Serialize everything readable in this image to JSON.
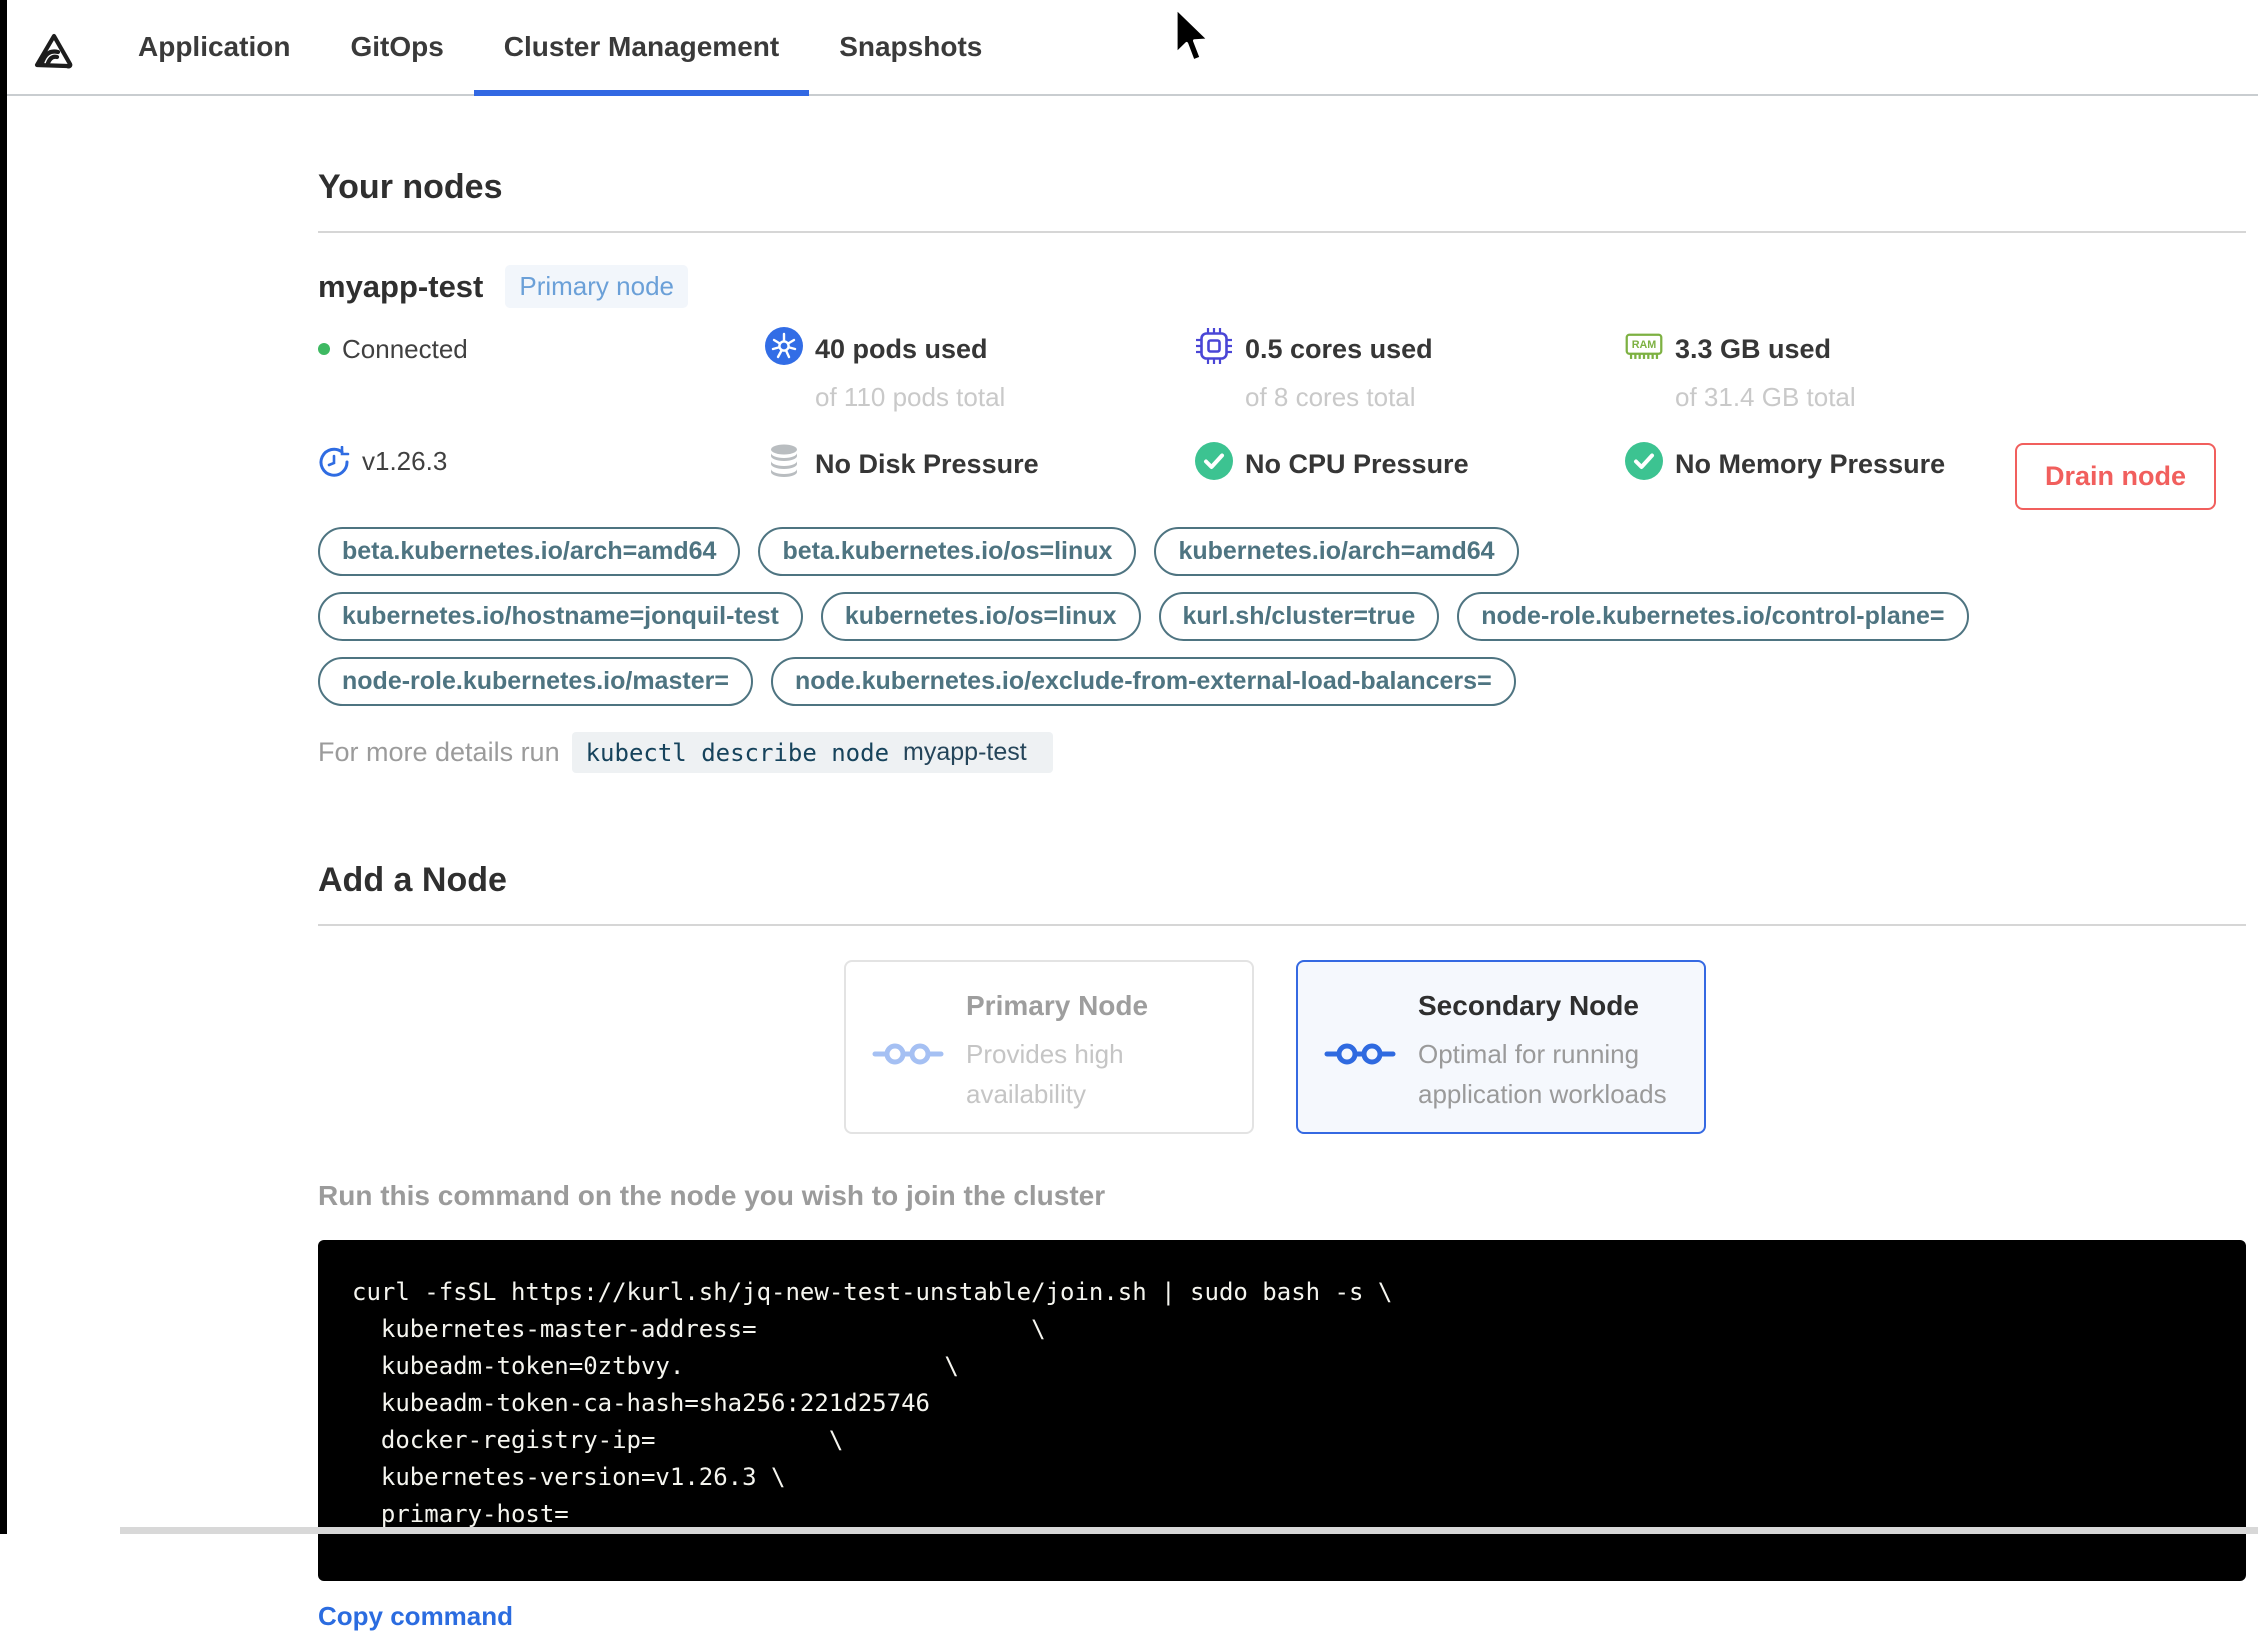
{
  "nav": {
    "tabs": [
      {
        "label": "Application"
      },
      {
        "label": "GitOps"
      },
      {
        "label": "Cluster Management"
      },
      {
        "label": "Snapshots"
      }
    ],
    "active_tab": "Cluster Management"
  },
  "your_nodes": {
    "title": "Your nodes",
    "node": {
      "name": "myapp-test",
      "badge": "Primary node",
      "status": "Connected",
      "version": "v1.26.3",
      "stats": [
        {
          "icon": "kubernetes-pods-icon",
          "label": "40 pods used",
          "sub": "of 110 pods total"
        },
        {
          "icon": "cpu-icon",
          "label": "0.5 cores used",
          "sub": "of 8 cores total"
        },
        {
          "icon": "ram-icon",
          "label": "3.3 GB used",
          "sub": "of 31.4 GB total"
        }
      ],
      "conditions": [
        {
          "icon": "disk-icon",
          "label": "No Disk Pressure"
        },
        {
          "icon": "check-circle-icon",
          "label": "No CPU Pressure"
        },
        {
          "icon": "check-circle-icon",
          "label": "No Memory Pressure"
        }
      ],
      "labels": [
        "beta.kubernetes.io/arch=amd64",
        "beta.kubernetes.io/os=linux",
        "kubernetes.io/arch=amd64",
        "kubernetes.io/hostname=jonquil-test",
        "kubernetes.io/os=linux",
        "kurl.sh/cluster=true",
        "node-role.kubernetes.io/control-plane=",
        "node-role.kubernetes.io/master=",
        "node.kubernetes.io/exclude-from-external-load-balancers="
      ],
      "details_prefix": "For more details run",
      "details_command": "kubectl describe node",
      "details_node": "myapp-test",
      "drain_button": "Drain node"
    }
  },
  "add_node": {
    "title": "Add a Node",
    "options": [
      {
        "title": "Primary Node",
        "description": "Provides high availability",
        "selected": false
      },
      {
        "title": "Secondary Node",
        "description": "Optimal for running application workloads",
        "selected": true
      }
    ],
    "instruction": "Run this command on the node you wish to join the cluster",
    "command_lines": [
      "curl -fsSL https://kurl.sh/jq-new-test-unstable/join.sh | sudo bash -s \\",
      "  kubernetes-master-address=                   \\",
      "  kubeadm-token=0ztbvy.                  \\",
      "  kubeadm-token-ca-hash=sha256:221d25746",
      "  docker-registry-ip=            \\",
      "  kubernetes-version=v1.26.3 \\",
      "  primary-host="
    ],
    "copy_label": "Copy command"
  },
  "colors": {
    "accent_blue": "#3268e3",
    "kubernetes_blue": "#326de6",
    "cpu_indigo": "#4a46d6",
    "ram_green": "#7db142",
    "check_green": "#3cc391",
    "connected_green": "#3eb962",
    "danger_red": "#f15f5d",
    "tag_slate": "#4e7481",
    "badge_blue": "#6ba0d8"
  }
}
